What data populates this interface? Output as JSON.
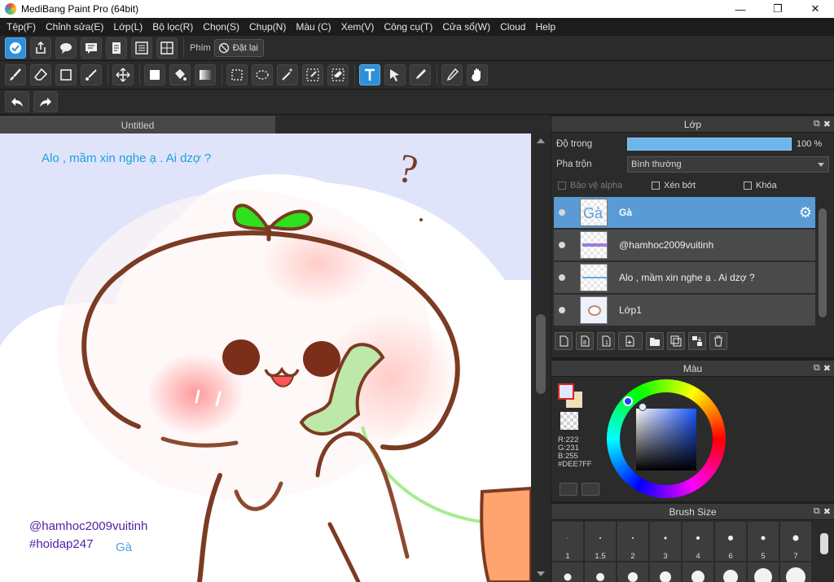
{
  "window": {
    "title": "MediBang Paint Pro (64bit)",
    "min": "—",
    "max": "❐",
    "close": "✕"
  },
  "menu": [
    "Tệp(F)",
    "Chỉnh sửa(E)",
    "Lớp(L)",
    "Bộ lọc(R)",
    "Chọn(S)",
    "Chụp(N)",
    "Màu (C)",
    "Xem(V)",
    "Công cụ(T)",
    "Cửa sổ(W)",
    "Cloud",
    "Help"
  ],
  "toolbar1": {
    "phim_label": "Phím",
    "reset_label": "Đặt lại"
  },
  "document": {
    "tab": "Untitled"
  },
  "canvas": {
    "caption": "Alo , mầm xin nghe ạ . Ai dzợ ?",
    "handle": "@hamhoc2009vuitinh",
    "hashtag": "#hoidap247",
    "signature": "Gà",
    "question_mark": "?"
  },
  "layers_panel": {
    "title": "Lớp",
    "opacity_label": "Độ trong",
    "opacity_value": "100 %",
    "opacity_fraction": 1.0,
    "blend_label": "Pha trộn",
    "blend_value": "Bình thường",
    "protect_alpha": "Bảo vệ alpha",
    "clipping": "Xén bớt",
    "lock": "Khóa",
    "layers": [
      {
        "name": "Gà",
        "selected": true,
        "thumb_text": "Gà"
      },
      {
        "name": "@hamhoc2009vuitinh",
        "selected": false
      },
      {
        "name": "Alo , mầm xin nghe ạ . Ai dzợ ?",
        "selected": false
      },
      {
        "name": "Lớp1",
        "selected": false
      }
    ]
  },
  "color_panel": {
    "title": "Màu",
    "r": "R:222",
    "g": "G:231",
    "b": "B:255",
    "hex": "#DEE7FF",
    "foreground": "#DEE7FF",
    "background": "#F4DEB4"
  },
  "brush_panel": {
    "title": "Brush Size",
    "sizes": [
      "1",
      "1.5",
      "2",
      "3",
      "4",
      "6",
      "5",
      "7"
    ]
  }
}
